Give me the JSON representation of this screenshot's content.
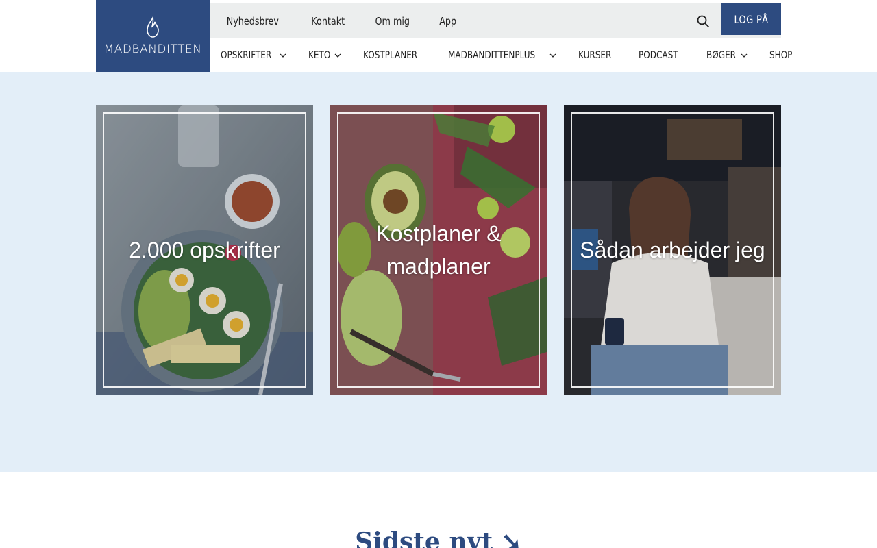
{
  "logo": {
    "text": "MADBANDITTEN",
    "icon": "flame-icon"
  },
  "topnav": [
    "Nyhedsbrev",
    "Kontakt",
    "Om mig",
    "App"
  ],
  "search": {
    "icon": "search-icon"
  },
  "login": {
    "label": "LOG PÅ"
  },
  "mainnav": [
    {
      "label": "OPSKRIFTER",
      "dropdown": true
    },
    {
      "label": "KETO",
      "dropdown": true
    },
    {
      "label": "KOSTPLANER",
      "dropdown": false
    },
    {
      "label": "MADBANDITTENPLUS",
      "dropdown": true
    },
    {
      "label": "KURSER",
      "dropdown": false
    },
    {
      "label": "PODCAST",
      "dropdown": false
    },
    {
      "label": "BØGER",
      "dropdown": true
    },
    {
      "label": "SHOP",
      "dropdown": false
    }
  ],
  "cards": [
    {
      "title": "2.000 opskrifter",
      "image": "food-bowl-image"
    },
    {
      "title": "Kostplaner & madplaner",
      "image": "avocado-herbs-image"
    },
    {
      "title": "Sådan arbejder jeg",
      "image": "woman-portrait-image"
    }
  ],
  "latest": {
    "title": "Sidste nyt ➘"
  },
  "colors": {
    "brand": "#2d4b80",
    "hero_bg": "#e3eef8",
    "topbar_bg": "#eceeee"
  }
}
